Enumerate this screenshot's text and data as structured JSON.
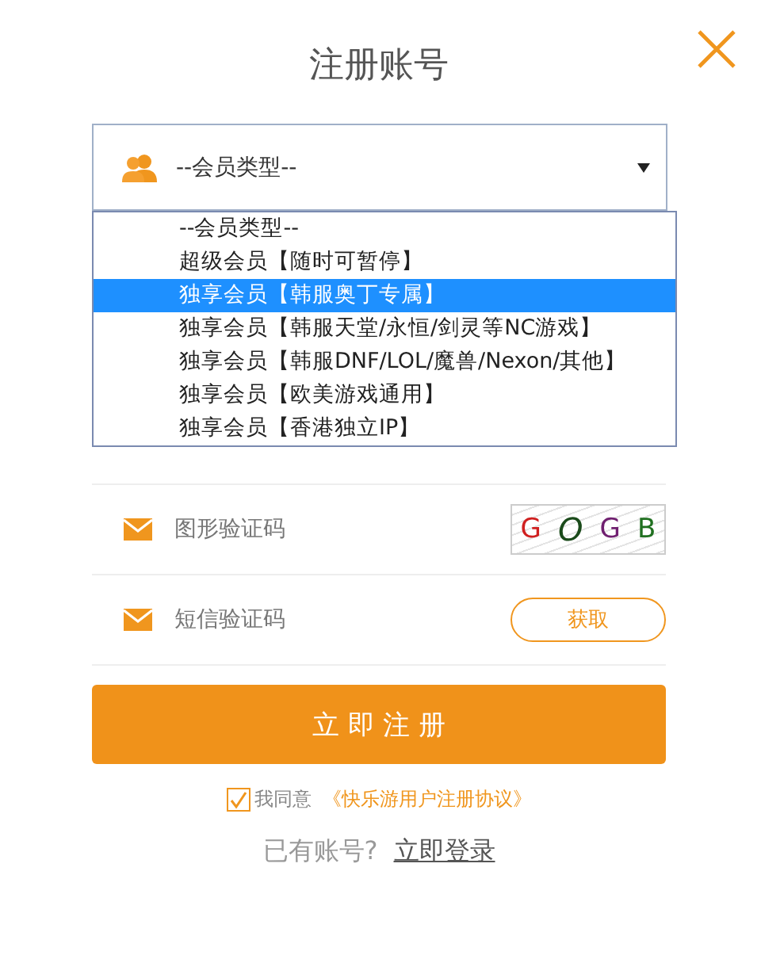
{
  "title": "注册账号",
  "member_select": {
    "value": "--会员类型--",
    "expanded": true,
    "options": [
      {
        "label": "--会员类型--",
        "highlighted": false
      },
      {
        "label": "超级会员【随时可暂停】",
        "highlighted": false
      },
      {
        "label": "独享会员【韩服奥丁专属】",
        "highlighted": true
      },
      {
        "label": "独享会员【韩服天堂/永恒/剑灵等NC游戏】",
        "highlighted": false
      },
      {
        "label": "独享会员【韩服DNF/LOL/魔兽/Nexon/其他】",
        "highlighted": false
      },
      {
        "label": "独享会员【欧美游戏通用】",
        "highlighted": false
      },
      {
        "label": "独享会员【香港独立IP】",
        "highlighted": false
      }
    ]
  },
  "fields": [
    {
      "placeholder": "图形验证码",
      "kind": "captcha",
      "captcha": [
        {
          "char": "G",
          "color": "#d02020"
        },
        {
          "char": "O",
          "color": "#1a4a1a"
        },
        {
          "char": "G",
          "color": "#702070"
        },
        {
          "char": "B",
          "color": "#207020"
        }
      ]
    },
    {
      "placeholder": "短信验证码",
      "kind": "sms",
      "button": "获取"
    }
  ],
  "register_button": "立 即 注 册",
  "agreement": {
    "checked": true,
    "text": "我同意",
    "link": "《快乐游用户注册协议》"
  },
  "login": {
    "text": "已有账号?",
    "link": "立即登录"
  }
}
